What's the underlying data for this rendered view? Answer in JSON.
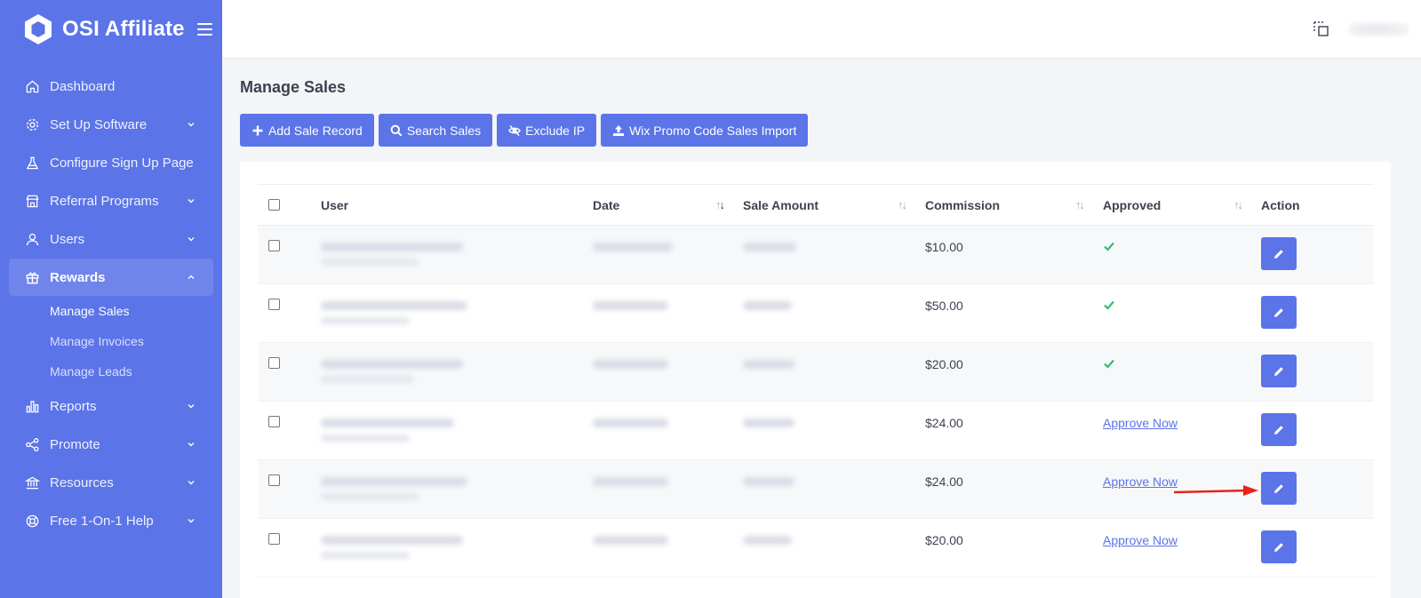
{
  "brand": {
    "name": "OSI Affiliate"
  },
  "sidebar": {
    "items": [
      {
        "label": "Dashboard",
        "icon": "home-icon",
        "has_chevron": false
      },
      {
        "label": "Set Up Software",
        "icon": "gear-icon",
        "has_chevron": true
      },
      {
        "label": "Configure Sign Up Page",
        "icon": "flask-icon",
        "has_chevron": false
      },
      {
        "label": "Referral Programs",
        "icon": "store-icon",
        "has_chevron": true
      },
      {
        "label": "Users",
        "icon": "user-icon",
        "has_chevron": true
      },
      {
        "label": "Rewards",
        "icon": "gift-icon",
        "has_chevron": true,
        "active": true
      },
      {
        "label": "Reports",
        "icon": "bar-chart-icon",
        "has_chevron": true
      },
      {
        "label": "Promote",
        "icon": "share-icon",
        "has_chevron": true
      },
      {
        "label": "Resources",
        "icon": "bank-icon",
        "has_chevron": true
      },
      {
        "label": "Free 1-On-1 Help",
        "icon": "lifebuoy-icon",
        "has_chevron": true
      }
    ],
    "rewards_sub": [
      {
        "label": "Manage Sales",
        "active": true
      },
      {
        "label": "Manage Invoices"
      },
      {
        "label": "Manage Leads"
      }
    ]
  },
  "main": {
    "title": "Manage Sales",
    "toolbar": {
      "add_label": "Add Sale Record",
      "search_label": "Search Sales",
      "exclude_label": "Exclude IP",
      "wix_label": "Wix Promo Code Sales Import"
    }
  },
  "table": {
    "headers": {
      "user": "User",
      "date": "Date",
      "sale_amount": "Sale Amount",
      "commission": "Commission",
      "approved": "Approved",
      "action": "Action"
    },
    "rows": [
      {
        "commission": "$10.00",
        "approved": true,
        "approve_label": ""
      },
      {
        "commission": "$50.00",
        "approved": true,
        "approve_label": ""
      },
      {
        "commission": "$20.00",
        "approved": true,
        "approve_label": ""
      },
      {
        "commission": "$24.00",
        "approved": false,
        "approve_label": "Approve Now"
      },
      {
        "commission": "$24.00",
        "approved": false,
        "approve_label": "Approve Now"
      },
      {
        "commission": "$20.00",
        "approved": false,
        "approve_label": "Approve Now"
      }
    ]
  },
  "colors": {
    "primary": "#5b74e8",
    "sidebar_active": "#6f85ec",
    "success": "#2fbf71",
    "annotation_arrow": "#e8231b"
  }
}
